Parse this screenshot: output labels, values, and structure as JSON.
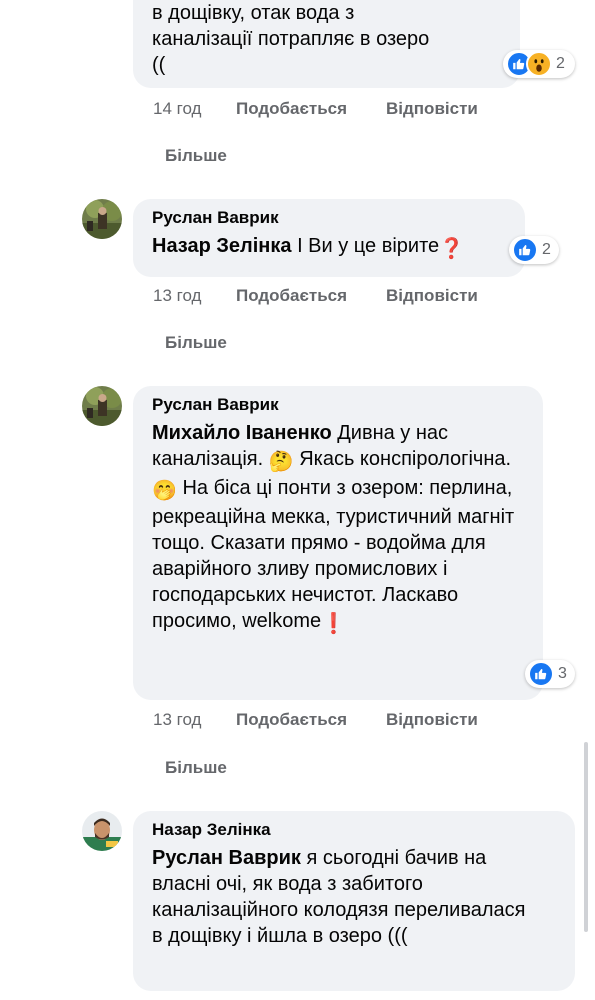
{
  "top_comment": {
    "text_lines": [
      "в дощівку, отак вода з",
      "каналізації потрапляє в озеро",
      "(("
    ],
    "reactions": {
      "icons": [
        "like-icon",
        "wow-icon"
      ],
      "count": "2"
    },
    "time": "14 год",
    "like_label": "Подобається",
    "reply_label": "Відповісти",
    "more_label": "Більше"
  },
  "comments": [
    {
      "author": "Руслан Ваврик",
      "mention": "Назар Зелінка",
      "text": " І Ви у це вірите",
      "trailing_emoji": "❓",
      "reactions": {
        "icons": [
          "like-icon"
        ],
        "count": "2"
      },
      "time": "13 год",
      "like_label": "Подобається",
      "reply_label": "Відповісти",
      "more_label": "Більше"
    },
    {
      "author": "Руслан Ваврик",
      "mention": "Михайло Іваненко",
      "text_part1": " Дивна у нас каналізація. ",
      "emoji1": "🤔",
      "text_part2": " Якась конспірологічна. ",
      "emoji2": "🤭",
      "text_part3": " На біса ці понти з озером: перлина, рекреаційна мекка, туристичний магніт тощо. Сказати прямо - водойма для аварійного зливу промислових і господарських нечистот. Ласкаво просимо, welkome",
      "trailing_emoji": "❗",
      "reactions": {
        "icons": [
          "like-icon"
        ],
        "count": "3"
      },
      "time": "13 год",
      "like_label": "Подобається",
      "reply_label": "Відповісти",
      "more_label": "Більше"
    },
    {
      "author": "Назар Зелінка",
      "mention": "Руслан Ваврик",
      "text": " я сьогодні бачив на власні очі, як вода з забитого каналізаційного колодязя переливалася в дощівку і йшла в озеро (((",
      "reactions": null
    }
  ],
  "colors": {
    "bubble_bg": "#f0f2f5",
    "meta_text": "#65676b",
    "like_blue": "#1877f2",
    "wow_yellow": "#f7b125"
  }
}
